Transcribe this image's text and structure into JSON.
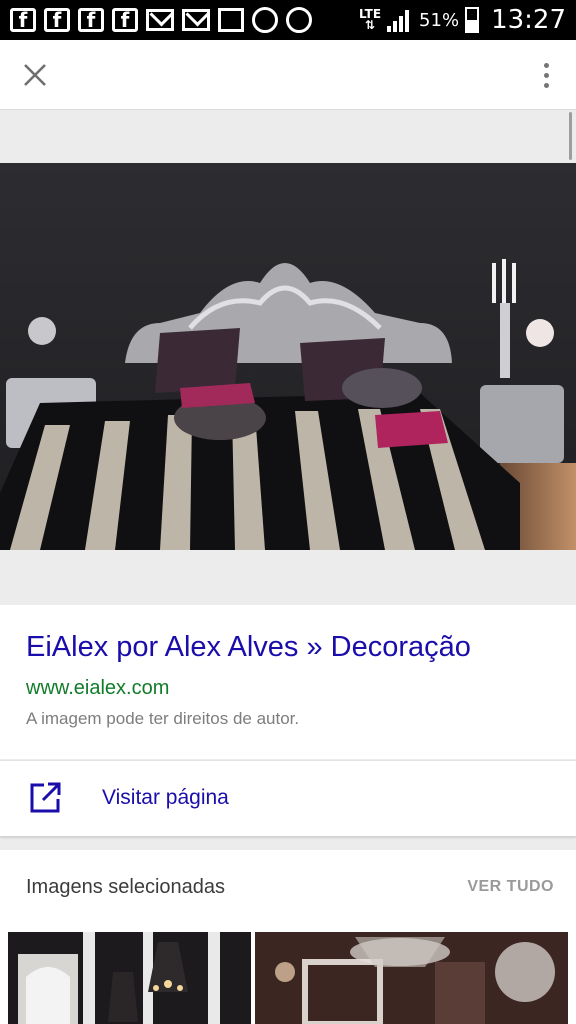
{
  "status_bar": {
    "notification_icons": [
      "facebook-icon",
      "facebook-icon",
      "facebook-icon",
      "facebook-icon",
      "gmail-icon",
      "gmail-icon",
      "gallery-icon",
      "sync-icon",
      "alarm-icon"
    ],
    "fb_glyph": "f",
    "network": "LTE",
    "battery": "51%",
    "time": "13:27"
  },
  "top_bar": {
    "close_icon": "close-icon",
    "menu_icon": "more-vert-icon"
  },
  "result": {
    "title": "EiAlex por Alex Alves » Decoração",
    "url": "www.eialex.com",
    "note": "A imagem pode ter direitos de autor."
  },
  "visit": {
    "label": "Visitar página",
    "icon": "open-in-new-icon"
  },
  "related": {
    "title": "Imagens selecionadas",
    "view_all": "VER TUDO"
  },
  "colors": {
    "link": "#1a0dab",
    "url": "#127c2a",
    "muted": "#7d7d7d"
  }
}
